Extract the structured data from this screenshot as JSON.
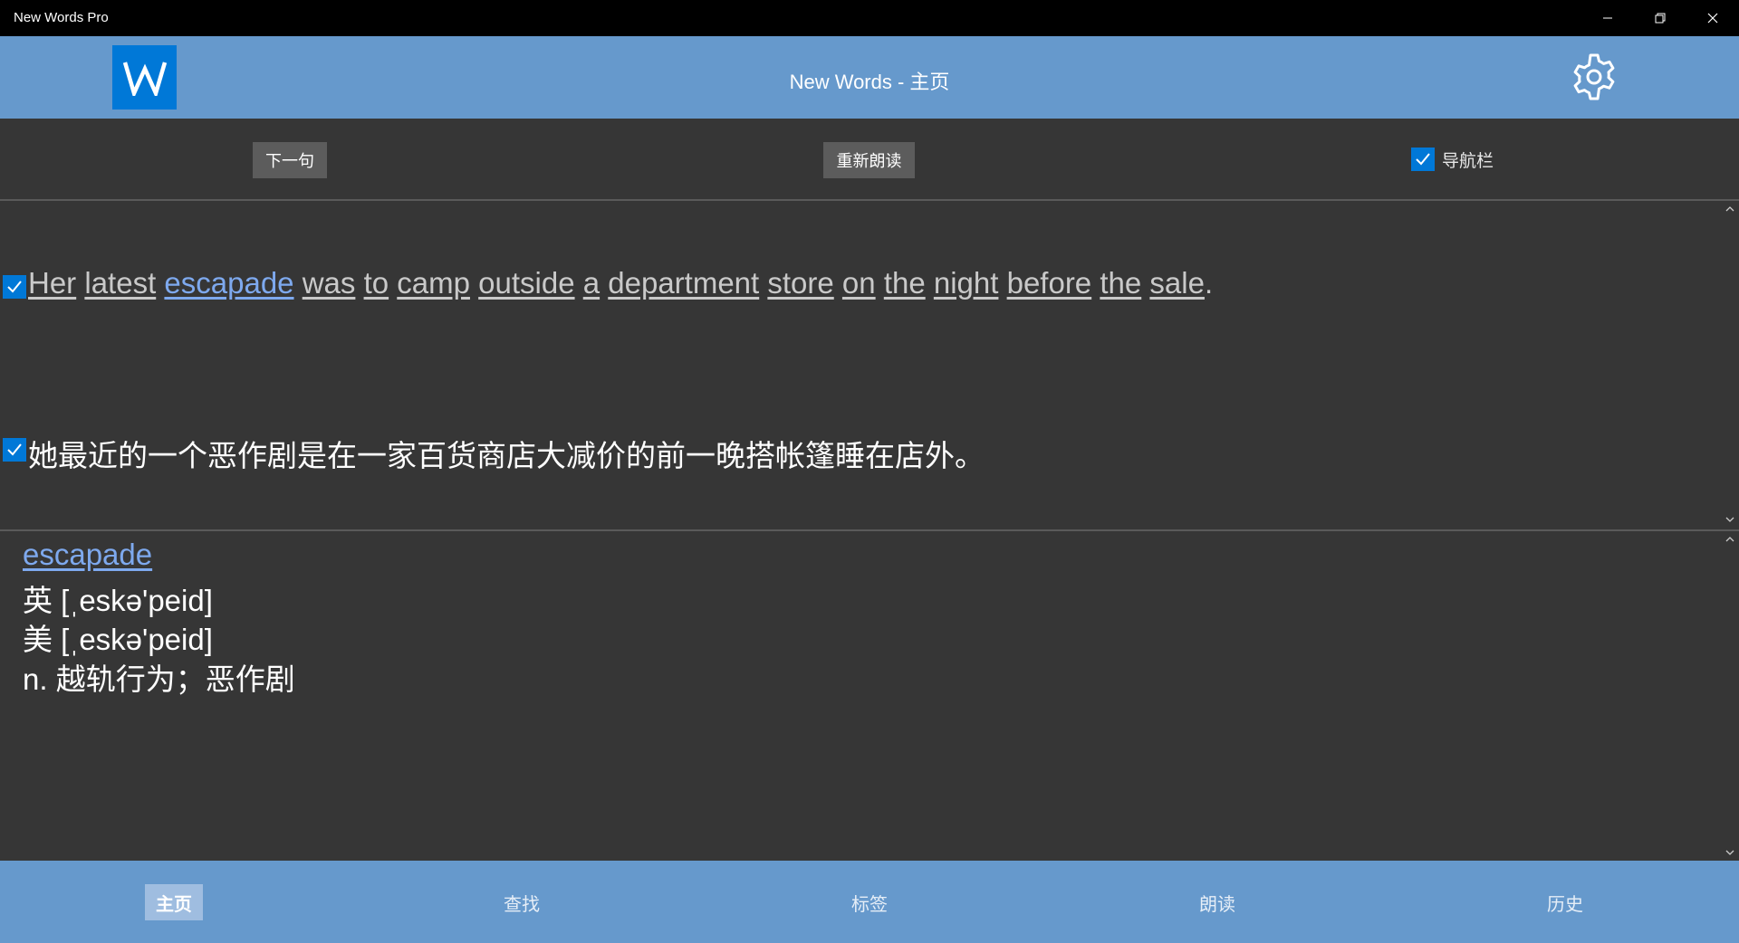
{
  "window": {
    "title": "New Words Pro"
  },
  "header": {
    "logo_letter": "W",
    "title": "New Words - 主页"
  },
  "toolbar": {
    "next_label": "下一句",
    "replay_label": "重新朗读",
    "nav_checkbox_label": "导航栏",
    "nav_checkbox_checked": true
  },
  "sentence": {
    "checked": true,
    "words": [
      "Her",
      "latest",
      "escapade",
      "was",
      "to",
      "camp",
      "outside",
      "a",
      "department",
      "store",
      "on",
      "the",
      "night",
      "before",
      "the",
      "sale"
    ],
    "highlighted_word": "escapade",
    "end_punct": "."
  },
  "translation": {
    "checked": true,
    "text": "她最近的一个恶作剧是在一家百货商店大减价的前一晚搭帐篷睡在店外。"
  },
  "definition": {
    "word": "escapade",
    "uk": "英 [ˌeskə'peid]",
    "us": "美 [ˌeskə'peid]",
    "meaning": "n. 越轨行为；恶作剧"
  },
  "bottom_nav": {
    "tabs": [
      {
        "label": "主页",
        "active": true
      },
      {
        "label": "查找",
        "active": false
      },
      {
        "label": "标签",
        "active": false
      },
      {
        "label": "朗读",
        "active": false
      },
      {
        "label": "历史",
        "active": false
      }
    ]
  },
  "colors": {
    "header": "#6699cc",
    "accent": "#0078d7",
    "link": "#7ea9ee",
    "background": "#363636"
  }
}
